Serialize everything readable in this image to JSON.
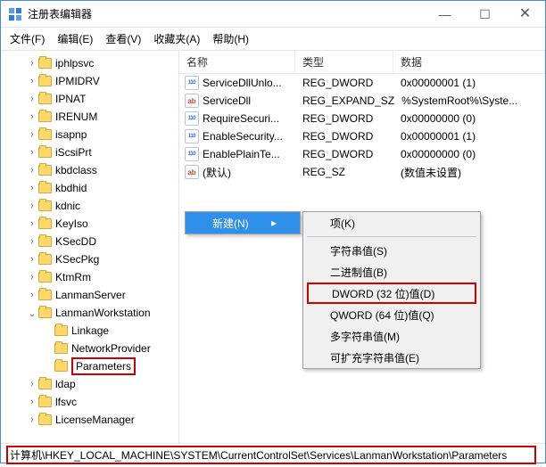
{
  "title": "注册表编辑器",
  "window_controls": {
    "min": "—",
    "max": "☐",
    "close": "✕"
  },
  "menu": [
    "文件(F)",
    "编辑(E)",
    "查看(V)",
    "收藏夹(A)",
    "帮助(H)"
  ],
  "tree": [
    {
      "label": "iphlpsvc",
      "ind": 28,
      "tw": ">"
    },
    {
      "label": "IPMIDRV",
      "ind": 28,
      "tw": ">"
    },
    {
      "label": "IPNAT",
      "ind": 28,
      "tw": ">"
    },
    {
      "label": "IRENUM",
      "ind": 28,
      "tw": ">"
    },
    {
      "label": "isapnp",
      "ind": 28,
      "tw": ">"
    },
    {
      "label": "iScsiPrt",
      "ind": 28,
      "tw": ">"
    },
    {
      "label": "kbdclass",
      "ind": 28,
      "tw": ">"
    },
    {
      "label": "kbdhid",
      "ind": 28,
      "tw": ">"
    },
    {
      "label": "kdnic",
      "ind": 28,
      "tw": ">"
    },
    {
      "label": "KeyIso",
      "ind": 28,
      "tw": ">"
    },
    {
      "label": "KSecDD",
      "ind": 28,
      "tw": ">"
    },
    {
      "label": "KSecPkg",
      "ind": 28,
      "tw": ">"
    },
    {
      "label": "KtmRm",
      "ind": 28,
      "tw": ">"
    },
    {
      "label": "LanmanServer",
      "ind": 28,
      "tw": ">"
    },
    {
      "label": "LanmanWorkstation",
      "ind": 28,
      "tw": "v"
    },
    {
      "label": "Linkage",
      "ind": 46,
      "tw": ""
    },
    {
      "label": "NetworkProvider",
      "ind": 46,
      "tw": ""
    },
    {
      "label": "Parameters",
      "ind": 46,
      "tw": "",
      "hl": true
    },
    {
      "label": "ldap",
      "ind": 28,
      "tw": ">"
    },
    {
      "label": "lfsvc",
      "ind": 28,
      "tw": ">"
    },
    {
      "label": "LicenseManager",
      "ind": 28,
      "tw": ">"
    }
  ],
  "columns": {
    "c1": "名称",
    "c2": "类型",
    "c3": "数据"
  },
  "rows": [
    {
      "icon": "str",
      "name": "(默认)",
      "type": "REG_SZ",
      "data": "(数值未设置)"
    },
    {
      "icon": "dw",
      "name": "EnablePlainTe...",
      "type": "REG_DWORD",
      "data": "0x00000000 (0)"
    },
    {
      "icon": "dw",
      "name": "EnableSecurity...",
      "type": "REG_DWORD",
      "data": "0x00000001 (1)"
    },
    {
      "icon": "dw",
      "name": "RequireSecuri...",
      "type": "REG_DWORD",
      "data": "0x00000000 (0)"
    },
    {
      "icon": "str",
      "name": "ServiceDll",
      "type": "REG_EXPAND_SZ",
      "data": "%SystemRoot%\\Syste..."
    },
    {
      "icon": "dw",
      "name": "ServiceDllUnlo...",
      "type": "REG_DWORD",
      "data": "0x00000001 (1)"
    }
  ],
  "ctx1": {
    "label": "新建(N)",
    "arrow": "▸"
  },
  "ctx2": [
    {
      "label": "项(K)"
    },
    {
      "sep": true
    },
    {
      "label": "字符串值(S)"
    },
    {
      "label": "二进制值(B)"
    },
    {
      "label": "DWORD (32 位)值(D)",
      "hl": true
    },
    {
      "label": "QWORD (64 位)值(Q)"
    },
    {
      "label": "多字符串值(M)"
    },
    {
      "label": "可扩充字符串值(E)"
    }
  ],
  "status_path": "计算机\\HKEY_LOCAL_MACHINE\\SYSTEM\\CurrentControlSet\\Services\\LanmanWorkstation\\Parameters"
}
